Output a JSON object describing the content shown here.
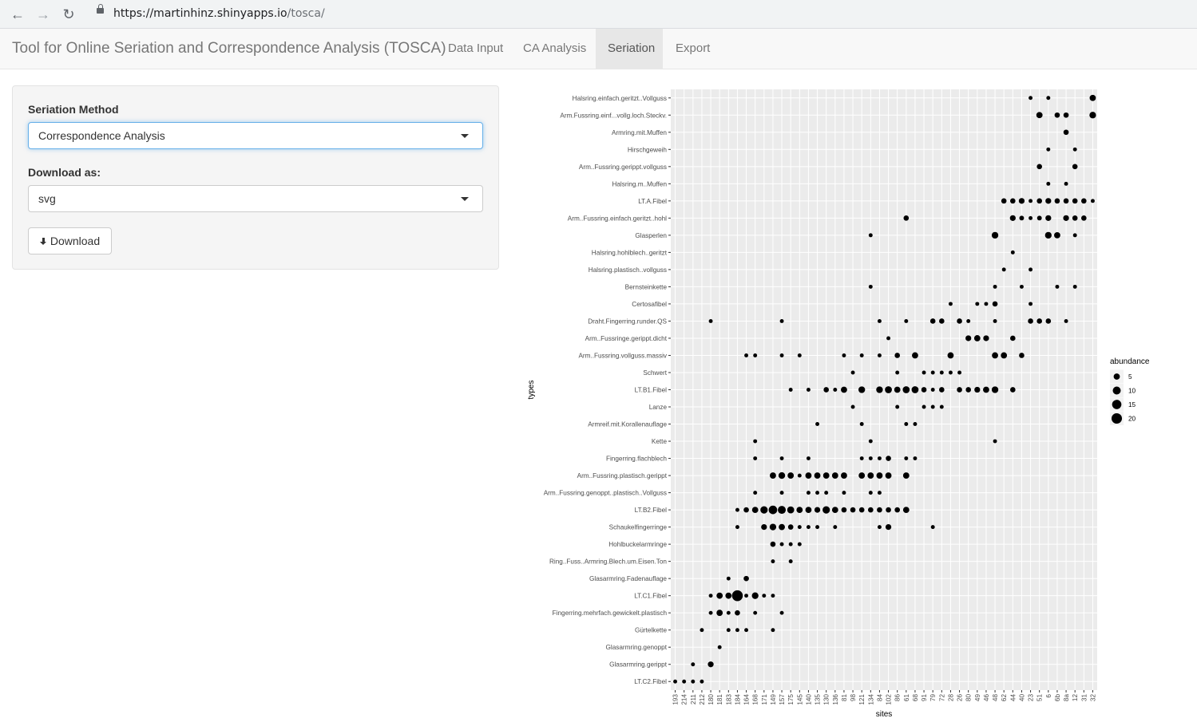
{
  "browser": {
    "url_host": "https://martinhinz.shinyapps.io",
    "url_path": "/tosca/"
  },
  "navbar": {
    "brand": "Tool for Online Seriation and Correspondence Analysis (TOSCA)",
    "tabs": [
      {
        "label": "Data Input",
        "active": false
      },
      {
        "label": "CA Analysis",
        "active": false
      },
      {
        "label": "Seriation",
        "active": true
      },
      {
        "label": "Export",
        "active": false
      }
    ]
  },
  "sidebar": {
    "method_label": "Seriation Method",
    "method_value": "Correspondence Analysis",
    "download_label": "Download as:",
    "download_value": "svg",
    "download_button": "Download"
  },
  "chart_data": {
    "type": "scatter",
    "xlabel": "sites",
    "ylabel": "types",
    "legend_title": "abundance",
    "legend_placement": "right",
    "legend_values": [
      5,
      10,
      15,
      20
    ],
    "size_scale_max": 23,
    "colors": {
      "panel": "#ebebeb",
      "grid": "#ffffff",
      "point": "#000000"
    },
    "x": [
      "193",
      "214",
      "211",
      "212",
      "180",
      "181",
      "183",
      "184",
      "164",
      "168",
      "171",
      "149",
      "157",
      "175",
      "145",
      "140",
      "135",
      "130",
      "136",
      "81",
      "98",
      "121",
      "134",
      "84",
      "102",
      "86",
      "61",
      "68",
      "91",
      "79",
      "72",
      "28",
      "26",
      "80",
      "49",
      "46",
      "48",
      "62",
      "44",
      "40",
      "23",
      "51",
      "6",
      "6b",
      "8a",
      "12",
      "31",
      "32"
    ],
    "types": [
      "Halsring.einfach.geritzt..Vollguss",
      "Arm.Fussring.einf...vollg.loch.Steckv.",
      "Armring.mit.Muffen",
      "Hirschgeweih",
      "Arm..Fussring.gerippt.vollguss",
      "Halsring.m..Muffen",
      "LT.A.Fibel",
      "Arm..Fussring.einfach.geritzt..hohl",
      "Glasperlen",
      "Halsring.hohlblech..geritzt",
      "Halsring.plastisch..vollguss",
      "Bernsteinkette",
      "Certosafibel",
      "Draht.Fingerring.runder.QS",
      "Arm..Fussringe.gerippt.dicht",
      "Arm..Fussring.vollguss.massiv",
      "Schwert",
      "LT.B1.Fibel",
      "Lanze",
      "Armreif.mit.Korallenauflage",
      "Kette",
      "Fingerring.flachblech",
      "Arm..Fussring.plastisch.gerippt",
      "Arm..Fussring.genoppt..plastisch..Vollguss",
      "LT.B2.Fibel",
      "Schaukelfingerringe",
      "Hohlbuckelarmringe",
      "Ring..Fuss..Armring.Blech.um.Eisen.Ton",
      "Glasarmring.Fadenauflage",
      "LT.C1.Fibel",
      "Fingerring.mehrfach.gewickelt.plastisch",
      "Gürtelkette",
      "Glasarmring.genoppt",
      "Glasarmring.gerippt",
      "LT.C2.Fibel"
    ],
    "points": [
      [
        "Halsring.einfach.geritzt..Vollguss",
        [
          [
            40,
            1
          ],
          [
            42,
            1
          ],
          [
            47,
            5
          ]
        ]
      ],
      [
        "Arm.Fussring.einf...vollg.loch.Steckv.",
        [
          [
            41,
            5
          ],
          [
            43,
            3
          ],
          [
            44,
            3
          ],
          [
            47,
            6
          ]
        ]
      ],
      [
        "Armring.mit.Muffen",
        [
          [
            44,
            3
          ]
        ]
      ],
      [
        "Hirschgeweih",
        [
          [
            42,
            1
          ],
          [
            45,
            1
          ]
        ]
      ],
      [
        "Arm..Fussring.gerippt.vollguss",
        [
          [
            41,
            3
          ],
          [
            45,
            3
          ]
        ]
      ],
      [
        "Halsring.m..Muffen",
        [
          [
            42,
            1
          ],
          [
            44,
            1
          ]
        ]
      ],
      [
        "LT.A.Fibel",
        [
          [
            37,
            3
          ],
          [
            38,
            3
          ],
          [
            39,
            4
          ],
          [
            40,
            1
          ],
          [
            41,
            3
          ],
          [
            42,
            4
          ],
          [
            43,
            3
          ],
          [
            44,
            3
          ],
          [
            45,
            3
          ],
          [
            46,
            3
          ],
          [
            47,
            1
          ]
        ]
      ],
      [
        "Arm..Fussring.einfach.geritzt..hohl",
        [
          [
            26,
            3
          ],
          [
            38,
            4
          ],
          [
            39,
            2
          ],
          [
            40,
            1
          ],
          [
            41,
            2
          ],
          [
            42,
            4
          ],
          [
            44,
            4
          ],
          [
            45,
            3
          ],
          [
            46,
            3
          ]
        ]
      ],
      [
        "Glasperlen",
        [
          [
            22,
            1
          ],
          [
            36,
            6
          ],
          [
            42,
            6
          ],
          [
            43,
            5
          ],
          [
            45,
            1
          ]
        ]
      ],
      [
        "Halsring.hohlblech..geritzt",
        [
          [
            38,
            1
          ]
        ]
      ],
      [
        "Halsring.plastisch..vollguss",
        [
          [
            37,
            1
          ],
          [
            40,
            1
          ]
        ]
      ],
      [
        "Bernsteinkette",
        [
          [
            22,
            1
          ],
          [
            36,
            1
          ],
          [
            39,
            1
          ],
          [
            43,
            1
          ],
          [
            45,
            1
          ]
        ]
      ],
      [
        "Certosafibel",
        [
          [
            31,
            1
          ],
          [
            34,
            1
          ],
          [
            35,
            1
          ],
          [
            36,
            3
          ],
          [
            40,
            1
          ]
        ]
      ],
      [
        "Draht.Fingerring.runder.QS",
        [
          [
            4,
            1
          ],
          [
            12,
            1
          ],
          [
            23,
            1
          ],
          [
            26,
            1
          ],
          [
            29,
            3
          ],
          [
            30,
            3
          ],
          [
            32,
            3
          ],
          [
            33,
            1
          ],
          [
            36,
            1
          ],
          [
            40,
            3
          ],
          [
            41,
            3
          ],
          [
            42,
            3
          ],
          [
            44,
            1
          ]
        ]
      ],
      [
        "Arm..Fussringe.gerippt.dicht",
        [
          [
            24,
            1
          ],
          [
            33,
            4
          ],
          [
            34,
            5
          ],
          [
            35,
            4
          ],
          [
            38,
            3
          ]
        ]
      ],
      [
        "Arm..Fussring.vollguss.massiv",
        [
          [
            8,
            1
          ],
          [
            9,
            1
          ],
          [
            12,
            1
          ],
          [
            14,
            1
          ],
          [
            19,
            1
          ],
          [
            21,
            1
          ],
          [
            23,
            1
          ],
          [
            25,
            3
          ],
          [
            27,
            5
          ],
          [
            31,
            5
          ],
          [
            36,
            5
          ],
          [
            37,
            5
          ],
          [
            39,
            3
          ]
        ]
      ],
      [
        "Schwert",
        [
          [
            20,
            1
          ],
          [
            25,
            1
          ],
          [
            28,
            1
          ],
          [
            29,
            1
          ],
          [
            30,
            1
          ],
          [
            31,
            1
          ],
          [
            32,
            1
          ]
        ]
      ],
      [
        "LT.B1.Fibel",
        [
          [
            13,
            1
          ],
          [
            15,
            1
          ],
          [
            17,
            3
          ],
          [
            18,
            1
          ],
          [
            19,
            5
          ],
          [
            21,
            6
          ],
          [
            23,
            6
          ],
          [
            24,
            7
          ],
          [
            25,
            5
          ],
          [
            26,
            7
          ],
          [
            27,
            7
          ],
          [
            28,
            3
          ],
          [
            29,
            1
          ],
          [
            30,
            3
          ],
          [
            32,
            3
          ],
          [
            33,
            3
          ],
          [
            34,
            4
          ],
          [
            35,
            5
          ],
          [
            36,
            6
          ],
          [
            38,
            3
          ]
        ]
      ],
      [
        "Lanze",
        [
          [
            20,
            1
          ],
          [
            25,
            1
          ],
          [
            28,
            1
          ],
          [
            29,
            1
          ],
          [
            30,
            1
          ]
        ]
      ],
      [
        "Armreif.mit.Korallenauflage",
        [
          [
            16,
            1
          ],
          [
            21,
            1
          ],
          [
            26,
            1
          ],
          [
            27,
            1
          ]
        ]
      ],
      [
        "Kette",
        [
          [
            9,
            1
          ],
          [
            22,
            1
          ],
          [
            36,
            1
          ]
        ]
      ],
      [
        "Fingerring.flachblech",
        [
          [
            9,
            1
          ],
          [
            12,
            1
          ],
          [
            15,
            1
          ],
          [
            21,
            1
          ],
          [
            22,
            1
          ],
          [
            23,
            1
          ],
          [
            24,
            3
          ],
          [
            26,
            1
          ],
          [
            27,
            1
          ]
        ]
      ],
      [
        "Arm..Fussring.plastisch.gerippt",
        [
          [
            11,
            5
          ],
          [
            12,
            6
          ],
          [
            13,
            5
          ],
          [
            14,
            1
          ],
          [
            15,
            5
          ],
          [
            16,
            5
          ],
          [
            17,
            5
          ],
          [
            18,
            5
          ],
          [
            19,
            5
          ],
          [
            21,
            5
          ],
          [
            22,
            5
          ],
          [
            23,
            5
          ],
          [
            24,
            5
          ],
          [
            26,
            5
          ]
        ]
      ],
      [
        "Arm..Fussring.genoppt..plastisch..Vollguss",
        [
          [
            9,
            1
          ],
          [
            12,
            1
          ],
          [
            15,
            1
          ],
          [
            16,
            1
          ],
          [
            17,
            1
          ],
          [
            19,
            1
          ],
          [
            22,
            1
          ],
          [
            23,
            1
          ]
        ]
      ],
      [
        "LT.B2.Fibel",
        [
          [
            7,
            1
          ],
          [
            8,
            3
          ],
          [
            9,
            5
          ],
          [
            10,
            8
          ],
          [
            11,
            12
          ],
          [
            12,
            10
          ],
          [
            13,
            7
          ],
          [
            14,
            5
          ],
          [
            15,
            5
          ],
          [
            16,
            4
          ],
          [
            17,
            8
          ],
          [
            18,
            5
          ],
          [
            19,
            3
          ],
          [
            20,
            3
          ],
          [
            21,
            3
          ],
          [
            22,
            3
          ],
          [
            23,
            3
          ],
          [
            24,
            3
          ],
          [
            25,
            3
          ],
          [
            26,
            5
          ]
        ]
      ],
      [
        "Schaukelfingerringe",
        [
          [
            7,
            1
          ],
          [
            10,
            4
          ],
          [
            11,
            6
          ],
          [
            12,
            5
          ],
          [
            13,
            3
          ],
          [
            14,
            1
          ],
          [
            15,
            1
          ],
          [
            16,
            1
          ],
          [
            18,
            1
          ],
          [
            23,
            1
          ],
          [
            24,
            4
          ],
          [
            29,
            1
          ]
        ]
      ],
      [
        "Hohlbuckelarmringe",
        [
          [
            11,
            3
          ],
          [
            12,
            1
          ],
          [
            13,
            1
          ],
          [
            14,
            1
          ]
        ]
      ],
      [
        "Ring..Fuss..Armring.Blech.um.Eisen.Ton",
        [
          [
            11,
            1
          ],
          [
            13,
            1
          ]
        ]
      ],
      [
        "Glasarmring.Fadenauflage",
        [
          [
            6,
            1
          ],
          [
            8,
            3
          ]
        ]
      ],
      [
        "LT.C1.Fibel",
        [
          [
            4,
            1
          ],
          [
            5,
            5
          ],
          [
            6,
            5
          ],
          [
            7,
            22
          ],
          [
            8,
            1
          ],
          [
            9,
            6
          ],
          [
            10,
            1
          ],
          [
            11,
            1
          ]
        ]
      ],
      [
        "Fingerring.mehrfach.gewickelt.plastisch",
        [
          [
            4,
            1
          ],
          [
            5,
            5
          ],
          [
            6,
            1
          ],
          [
            7,
            3
          ],
          [
            9,
            1
          ],
          [
            12,
            1
          ]
        ]
      ],
      [
        "Gürtelkette",
        [
          [
            3,
            1
          ],
          [
            6,
            1
          ],
          [
            7,
            1
          ],
          [
            8,
            1
          ],
          [
            11,
            1
          ]
        ]
      ],
      [
        "Glasarmring.genoppt",
        [
          [
            5,
            1
          ]
        ]
      ],
      [
        "Glasarmring.gerippt",
        [
          [
            2,
            1
          ],
          [
            4,
            4
          ]
        ]
      ],
      [
        "LT.C2.Fibel",
        [
          [
            0,
            1
          ],
          [
            1,
            1
          ],
          [
            2,
            1
          ],
          [
            3,
            1
          ]
        ]
      ]
    ]
  }
}
